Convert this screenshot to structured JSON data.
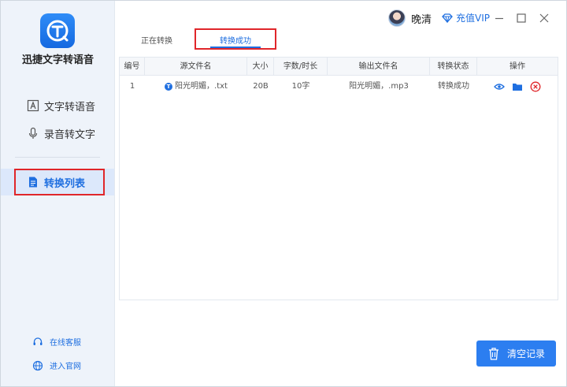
{
  "app": {
    "title": "迅捷文字转语音"
  },
  "sidebar": {
    "items": [
      {
        "label": "文字转语音",
        "icon": "text-a-icon"
      },
      {
        "label": "录音转文字",
        "icon": "microphone-icon"
      },
      {
        "label": "转换列表",
        "icon": "document-list-icon",
        "active": true
      }
    ],
    "footer": [
      {
        "label": "在线客服",
        "icon": "headset-icon"
      },
      {
        "label": "进入官网",
        "icon": "globe-icon"
      }
    ]
  },
  "header": {
    "username": "晚清",
    "vip_label": "充值VIP",
    "vip_icon": "diamond-icon"
  },
  "tabs": [
    {
      "label": "正在转换",
      "active": false
    },
    {
      "label": "转换成功",
      "active": true
    }
  ],
  "table": {
    "columns": [
      "编号",
      "源文件名",
      "大小",
      "字数/时长",
      "输出文件名",
      "转换状态",
      "操作"
    ],
    "rows": [
      {
        "index": "1",
        "source_badge": "T",
        "source": "阳光明媚，.txt",
        "size": "20B",
        "length": "10字",
        "output": "阳光明媚，.mp3",
        "status": "转换成功",
        "actions": [
          "eye-icon",
          "folder-icon",
          "delete-circle-icon"
        ]
      }
    ]
  },
  "clear_button": {
    "label": "清空记录",
    "icon": "trash-icon"
  },
  "colors": {
    "accent": "#1f6fe0",
    "highlight_box": "#e0262a",
    "sidebar_bg": "#eef3fa"
  }
}
